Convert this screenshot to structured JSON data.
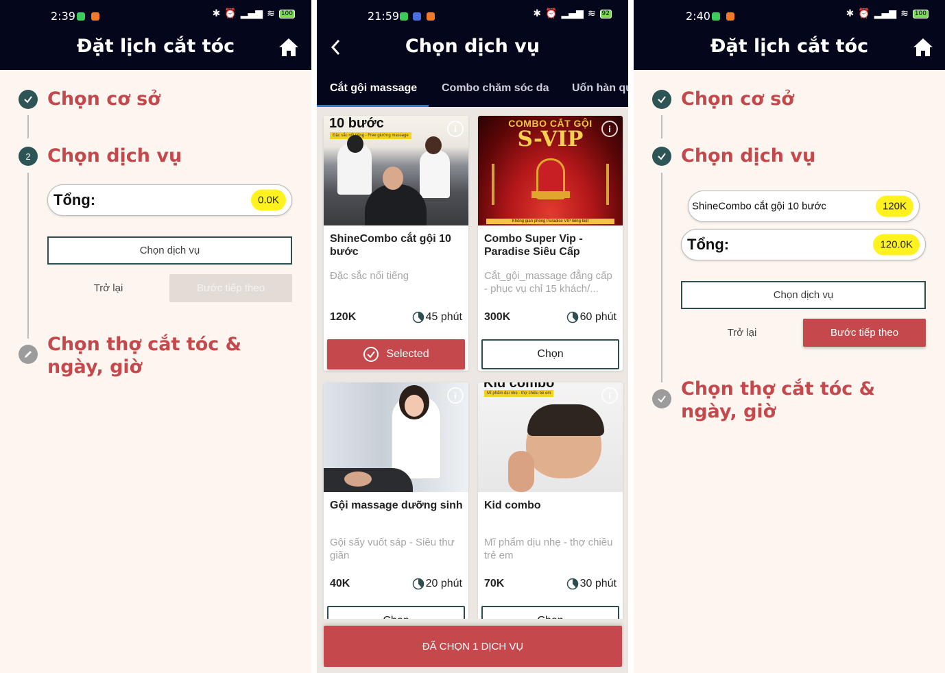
{
  "phone1": {
    "status": {
      "time": "2:39",
      "battery": "100"
    },
    "title": "Đặt lịch cắt tóc",
    "steps": [
      {
        "label": "Chọn cơ sở"
      },
      {
        "number": "2",
        "label": "Chọn dịch vụ"
      },
      {
        "label": "Chọn thợ cắt tóc & ngày, giờ"
      }
    ],
    "total_label": "Tổng:",
    "total_value": "0.0K",
    "choose_service_button": "Chọn dịch vụ",
    "back_button": "Trở lại",
    "next_button": "Bước tiếp theo"
  },
  "phone2": {
    "status": {
      "time": "21:59",
      "battery": "92"
    },
    "title": "Chọn dịch vụ",
    "tabs": [
      {
        "label": "Cắt gội massage",
        "active": true
      },
      {
        "label": "Combo chăm sóc da"
      },
      {
        "label": "Uốn hàn qu"
      }
    ],
    "cards": [
      {
        "image_title": "10 bước",
        "image_caption": "Đặc sắc nổi tiếng - Free giường massage",
        "name": "ShineCombo cắt gội 10 bước",
        "desc": "Đặc sắc nổi tiếng",
        "price": "120K",
        "duration": "45 phút",
        "button": "Selected",
        "selected": true
      },
      {
        "image_title": "COMBO CẮT GỘI",
        "image_subtitle": "S-VIP",
        "image_caption": "Không gian phòng Paradise VIP riêng biệt",
        "name": "Combo Super Vip - Paradise Siêu Cấp",
        "desc": "Cắt_gội_massage đẳng cấp - phục vụ chỉ 15 khách/...",
        "price": "300K",
        "duration": "60 phút",
        "button": "Chọn"
      },
      {
        "name": "Gội massage dưỡng sinh",
        "desc": "Gội sấy vuốt sáp - Siêu thư giãn",
        "price": "40K",
        "duration": "20 phút",
        "button": "Chọn"
      },
      {
        "image_title": "Kid combo",
        "image_caption": "Mĩ phẩm dịu nhẹ - thợ chiều bé em",
        "name": "Kid combo",
        "desc": "Mĩ phẩm dịu nhẹ - thợ chiều trẻ em",
        "price": "70K",
        "duration": "30 phút",
        "button": "Chọn"
      }
    ],
    "bottom_button": "ĐÃ CHỌN 1 DỊCH VỤ"
  },
  "phone3": {
    "status": {
      "time": "2:40",
      "battery": "100"
    },
    "title": "Đặt lịch cắt tóc",
    "steps": [
      {
        "label": "Chọn cơ sở"
      },
      {
        "label": "Chọn dịch vụ"
      },
      {
        "label": "Chọn thợ cắt tóc & ngày, giờ"
      }
    ],
    "selected_service": {
      "name": "ShineCombo cắt gội 10 bước",
      "price": "120K"
    },
    "total_label": "Tổng:",
    "total_value": "120.0K",
    "choose_service_button": "Chọn dịch vụ",
    "back_button": "Trở lại",
    "next_button": "Bước tiếp theo"
  },
  "colors": {
    "header": "#04071c",
    "accent": "#c5484c",
    "step_done": "#2d5556",
    "price_badge": "#fff21f"
  }
}
